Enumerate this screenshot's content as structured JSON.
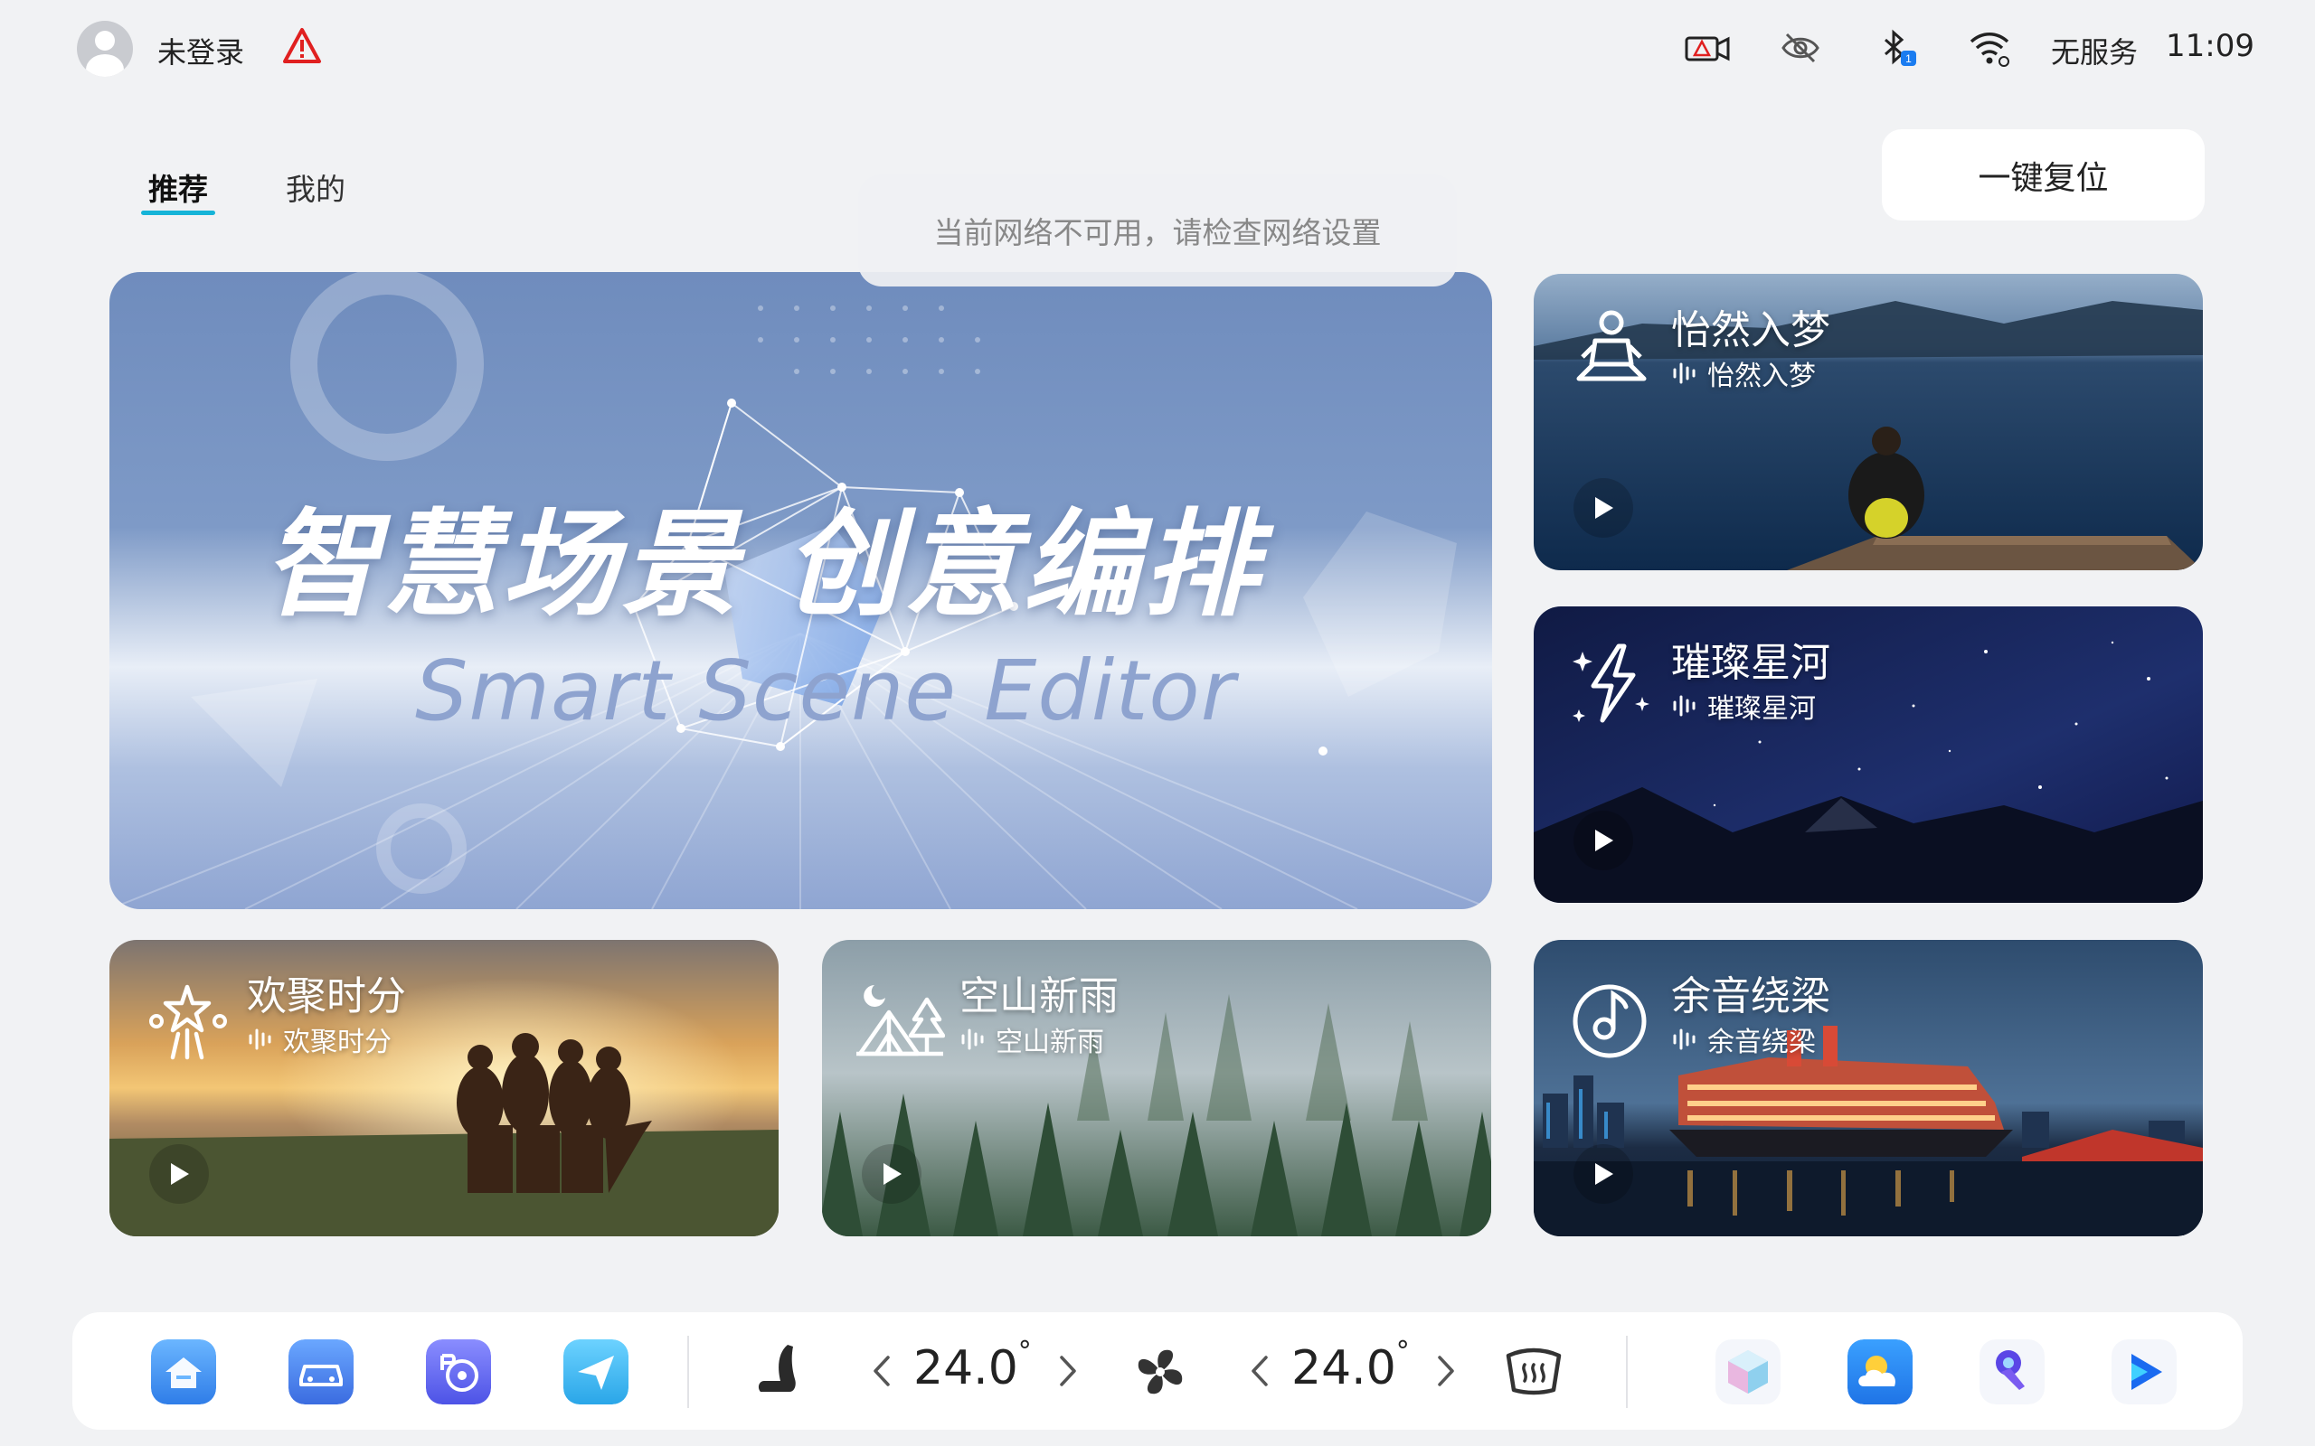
{
  "status": {
    "login_text": "未登录",
    "network_label": "无服务",
    "time": "11:09",
    "bluetooth_badge": "1"
  },
  "tabs": [
    {
      "label": "推荐",
      "active": true
    },
    {
      "label": "我的",
      "active": false
    }
  ],
  "toast": "当前网络不可用，请检查网络设置",
  "reset_button": "一键复位",
  "hero": {
    "title": "智慧场景  创意编排",
    "subtitle": "Smart Scene Editor"
  },
  "cards": [
    {
      "title": "怡然入梦",
      "voice": "怡然入梦",
      "icon": "meditation-icon"
    },
    {
      "title": "璀璨星河",
      "voice": "璀璨星河",
      "icon": "lightning-sparkle-icon"
    },
    {
      "title": "欢聚时分",
      "voice": "欢聚时分",
      "icon": "fireworks-icon"
    },
    {
      "title": "空山新雨",
      "voice": "空山新雨",
      "icon": "camping-tent-icon"
    },
    {
      "title": "余音绕梁",
      "voice": "余音绕梁",
      "icon": "music-note-icon"
    }
  ],
  "climate": {
    "left_temp": "24.0",
    "right_temp": "24.0",
    "degree": "°"
  },
  "dock_icons": [
    "home-icon",
    "car-icon",
    "steering-wheel-icon",
    "navigation-icon",
    "seat-icon",
    "fan-icon",
    "rear-defrost-icon",
    "cube-app-icon",
    "weather-app-icon",
    "voice-mic-app-icon",
    "video-play-app-icon"
  ],
  "colors": {
    "accent": "#16b4d8",
    "warning": "#e02020"
  }
}
